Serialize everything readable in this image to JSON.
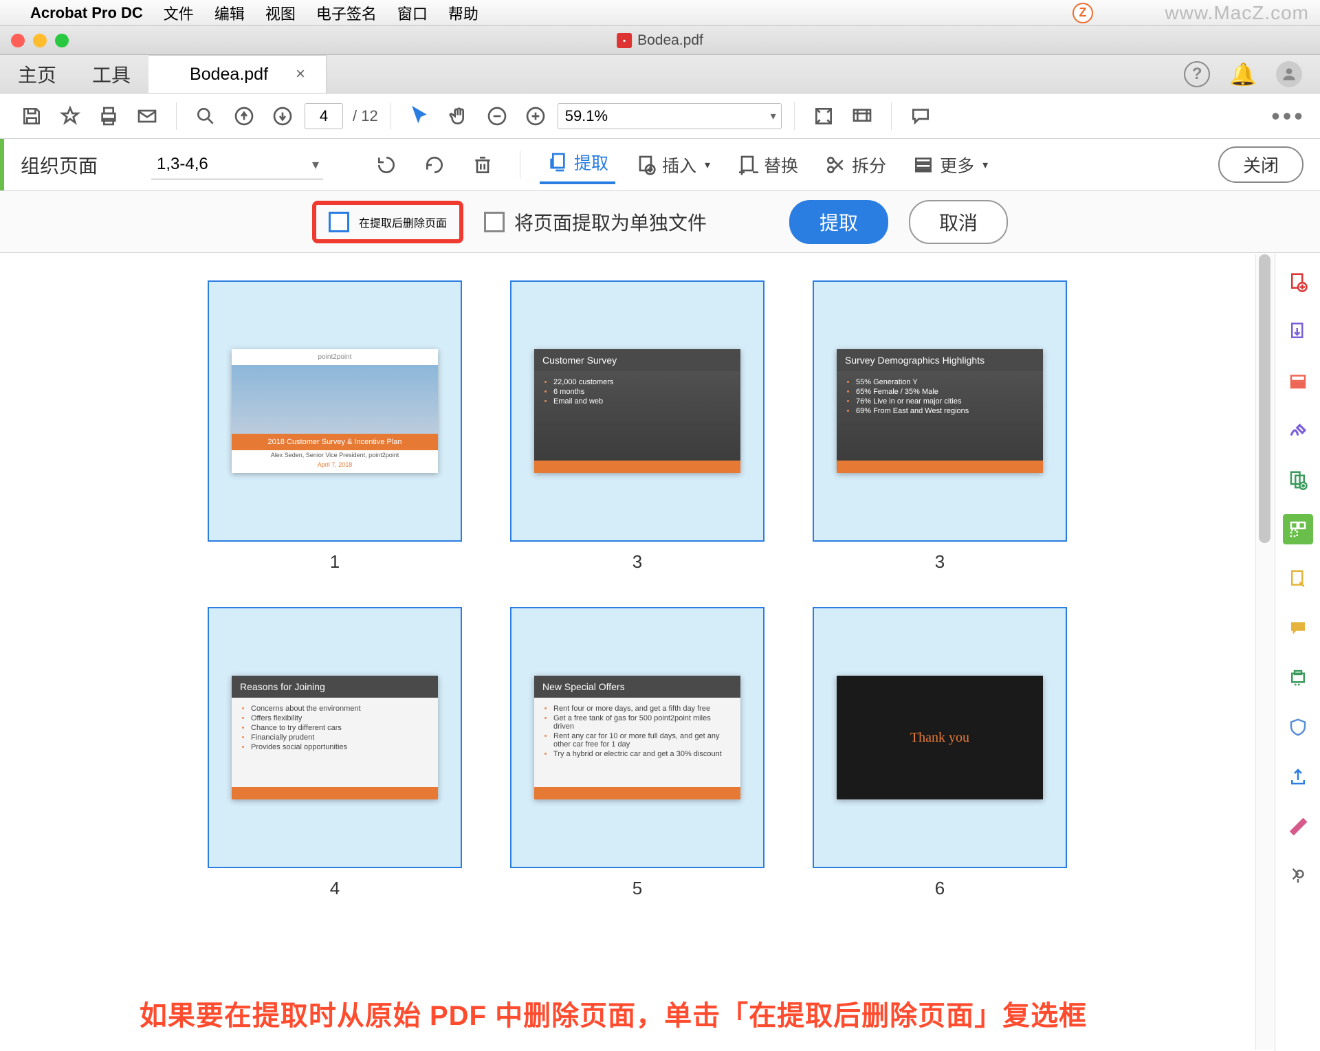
{
  "menubar": {
    "app_name": "Acrobat Pro DC",
    "items": [
      "文件",
      "编辑",
      "视图",
      "电子签名",
      "窗口",
      "帮助"
    ],
    "watermark_url": "www.MacZ.com",
    "z_badge": "Z"
  },
  "window": {
    "title": "Bodea.pdf"
  },
  "tabs": {
    "home": "主页",
    "tools": "工具",
    "active": "Bodea.pdf"
  },
  "toolbar": {
    "page_current": "4",
    "page_total": "/ 12",
    "zoom": "59.1%"
  },
  "organize": {
    "title": "组织页面",
    "range": "1,3-4,6",
    "extract": "提取",
    "insert": "插入",
    "replace": "替换",
    "split": "拆分",
    "more": "更多",
    "close": "关闭"
  },
  "extract_opts": {
    "delete_after": "在提取后删除页面",
    "separate_files": "将页面提取为单独文件",
    "extract_btn": "提取",
    "cancel_btn": "取消"
  },
  "thumbnails": [
    {
      "num": "1",
      "title": "2018 Customer Survey & Incentive Plan",
      "sub": "Alex Seden, Senior Vice President, point2point",
      "date": "April 7, 2018",
      "brand": "point2point",
      "type": "cover"
    },
    {
      "num": "3",
      "title": "Customer Survey",
      "bullets": [
        "22,000 customers",
        "6 months",
        "Email and web"
      ],
      "type": "dark"
    },
    {
      "num": "3",
      "title": "Survey Demographics Highlights",
      "bullets": [
        "55% Generation Y",
        "65% Female / 35% Male",
        "76% Live in or near major cities",
        "69% From East and West regions"
      ],
      "type": "dark"
    },
    {
      "num": "4",
      "title": "Reasons for Joining",
      "bullets": [
        "Concerns about the environment",
        "Offers flexibility",
        "Chance to try different cars",
        "Financially prudent",
        "Provides social opportunities"
      ],
      "type": "light"
    },
    {
      "num": "5",
      "title": "New Special Offers",
      "bullets": [
        "Rent four or more days, and get a fifth day free",
        "Get a free tank of gas for 500 point2point miles driven",
        "Rent any car for 10 or more full days, and get any other car free for 1 day",
        "Try a hybrid or electric car and get a 30% discount"
      ],
      "type": "light"
    },
    {
      "num": "6",
      "title": "Thank you",
      "type": "thanks"
    }
  ],
  "caption": "如果要在提取时从原始 PDF 中删除页面，单击「在提取后删除页面」复选框"
}
